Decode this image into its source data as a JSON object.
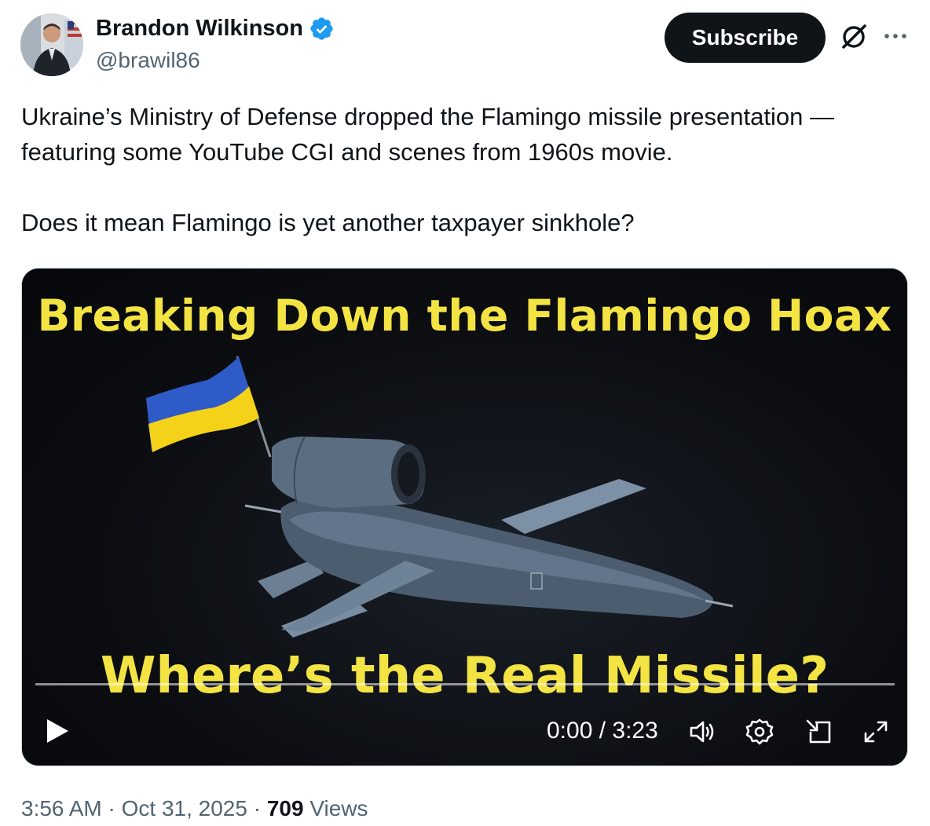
{
  "author": {
    "display_name": "Brandon Wilkinson",
    "handle": "@brawil86",
    "verified": true,
    "verified_color": "#1d9bf0"
  },
  "header": {
    "subscribe_label": "Subscribe",
    "grok_icon": "grok-icon",
    "more_icon": "more-icon"
  },
  "tweet": {
    "paragraphs": [
      "Ukraine’s Ministry of Defense dropped the Flamingo missile presentation — featuring some YouTube CGI and scenes from 1960s movie.",
      "Does it mean Flamingo is yet another taxpayer sinkhole?"
    ]
  },
  "video": {
    "overlay_title": "Breaking Down the Flamingo Hoax",
    "overlay_subtitle": "Where’s the Real Missile?",
    "overlay_text_color": "#f3e443",
    "time": "0:00 / 3:23",
    "progress": 0,
    "controls": [
      "play-icon",
      "volume-icon",
      "settings-icon",
      "picture-in-picture-icon",
      "fullscreen-icon"
    ]
  },
  "footer": {
    "time": "3:56 AM",
    "separator": "·",
    "date": "Oct 31, 2025",
    "views_count": "709",
    "views_label": "Views"
  }
}
